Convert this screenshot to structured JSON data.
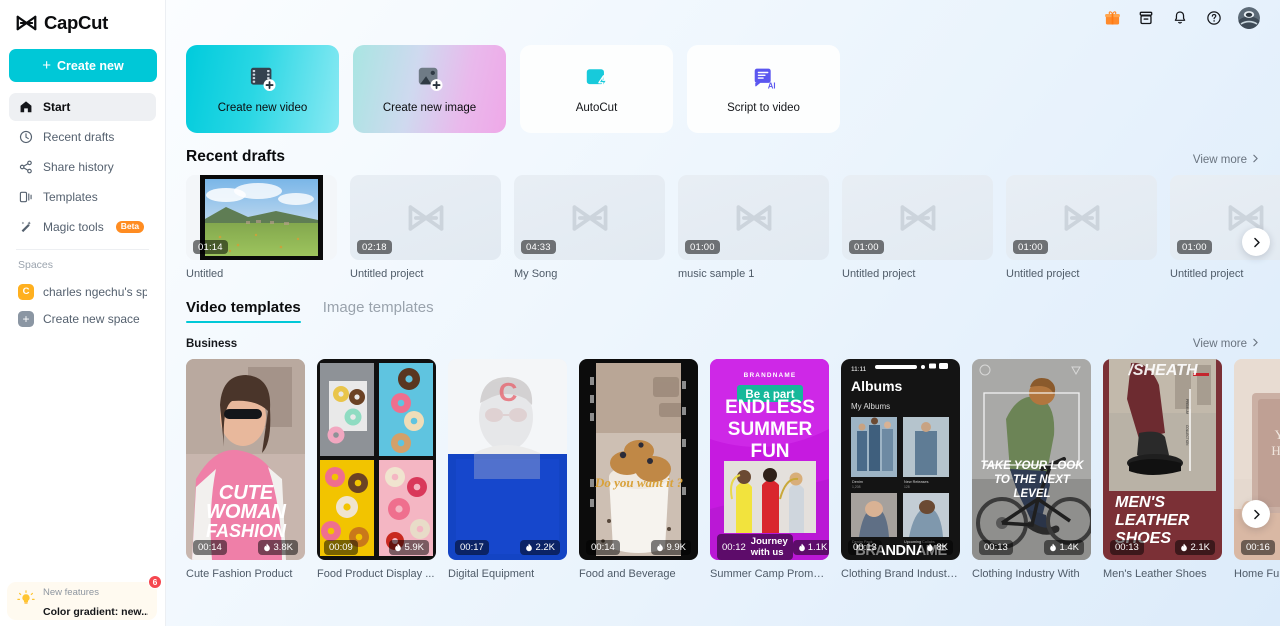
{
  "brand": {
    "name": "CapCut",
    "logo_icon": "capcut-logo-icon"
  },
  "sidebar": {
    "create_new_label": "Create new",
    "items": [
      {
        "label": "Start",
        "icon": "home-icon",
        "active": true
      },
      {
        "label": "Recent drafts",
        "icon": "clock-icon",
        "active": false
      },
      {
        "label": "Share history",
        "icon": "share-icon",
        "active": false
      },
      {
        "label": "Templates",
        "icon": "templates-icon",
        "active": false
      },
      {
        "label": "Magic tools",
        "icon": "magic-wand-icon",
        "active": false,
        "badge": "Beta"
      }
    ],
    "spaces_label": "Spaces",
    "spaces": [
      {
        "label": "charles ngechu's spa...",
        "avatar_letter": "C",
        "avatar_color": "#ffb01f"
      },
      {
        "label": "Create new space",
        "avatar_letter": "+",
        "avatar_color": "#8b96a3"
      }
    ],
    "new_features": {
      "eyebrow": "New features",
      "title": "Color gradient: new...",
      "badge_count": "6",
      "icon": "lightbulb-icon"
    }
  },
  "topbar": {
    "icons": [
      {
        "name": "gift-box-icon",
        "color": "#ff8a2b"
      },
      {
        "name": "archive-box-icon",
        "color": "#14161a"
      },
      {
        "name": "bell-icon",
        "color": "#14161a"
      },
      {
        "name": "help-circle-icon",
        "color": "#14161a"
      }
    ],
    "avatar": "user-avatar"
  },
  "actions": [
    {
      "label": "Create new video",
      "icon": "film-plus-icon",
      "style": "video"
    },
    {
      "label": "Create new image",
      "icon": "image-plus-icon",
      "style": "image"
    },
    {
      "label": "AutoCut",
      "icon": "autocut-icon",
      "style": "plain"
    },
    {
      "label": "Script to video",
      "icon": "script-ai-icon",
      "style": "plain"
    }
  ],
  "recent_drafts": {
    "title": "Recent drafts",
    "view_more": "View more",
    "items": [
      {
        "name": "Untitled",
        "duration": "01:14",
        "has_thumbnail": true
      },
      {
        "name": "Untitled project",
        "duration": "02:18",
        "has_thumbnail": false
      },
      {
        "name": "My Song",
        "duration": "04:33",
        "has_thumbnail": false
      },
      {
        "name": "music sample 1",
        "duration": "01:00",
        "has_thumbnail": false
      },
      {
        "name": "Untitled project",
        "duration": "01:00",
        "has_thumbnail": false
      },
      {
        "name": "Untitled project",
        "duration": "01:00",
        "has_thumbnail": false
      },
      {
        "name": "Untitled project",
        "duration": "01:00",
        "has_thumbnail": false
      }
    ]
  },
  "templates": {
    "tabs": [
      {
        "label": "Video templates",
        "active": true
      },
      {
        "label": "Image templates",
        "active": false
      }
    ],
    "category": "Business",
    "view_more": "View more",
    "items": [
      {
        "name": "Cute Fashion Product",
        "duration": "00:14",
        "likes": "3.8K",
        "style": "fashion"
      },
      {
        "name": "Food Product Display ...",
        "duration": "00:09",
        "likes": "5.9K",
        "style": "donuts"
      },
      {
        "name": "Digital Equipment",
        "duration": "00:17",
        "likes": "2.2K",
        "style": "digital"
      },
      {
        "name": "Food and Beverage",
        "duration": "00:14",
        "likes": "9.9K",
        "style": "coffee"
      },
      {
        "name": "Summer Camp Promotion",
        "duration": "00:12",
        "likes": "1.1K",
        "style": "summer"
      },
      {
        "name": "Clothing Brand Industry In",
        "duration": "00:13",
        "likes": "8K",
        "style": "albums"
      },
      {
        "name": "Clothing Industry With",
        "duration": "00:13",
        "likes": "1.4K",
        "style": "bike"
      },
      {
        "name": "Men's Leather Shoes",
        "duration": "00:13",
        "likes": "2.1K",
        "style": "shoes"
      },
      {
        "name": "Home Furni",
        "duration": "00:16",
        "likes": "",
        "style": "home"
      }
    ]
  },
  "colors": {
    "accent": "#00c8d7",
    "badge_orange": "#ff8c21",
    "notification_red": "#f5474f"
  }
}
